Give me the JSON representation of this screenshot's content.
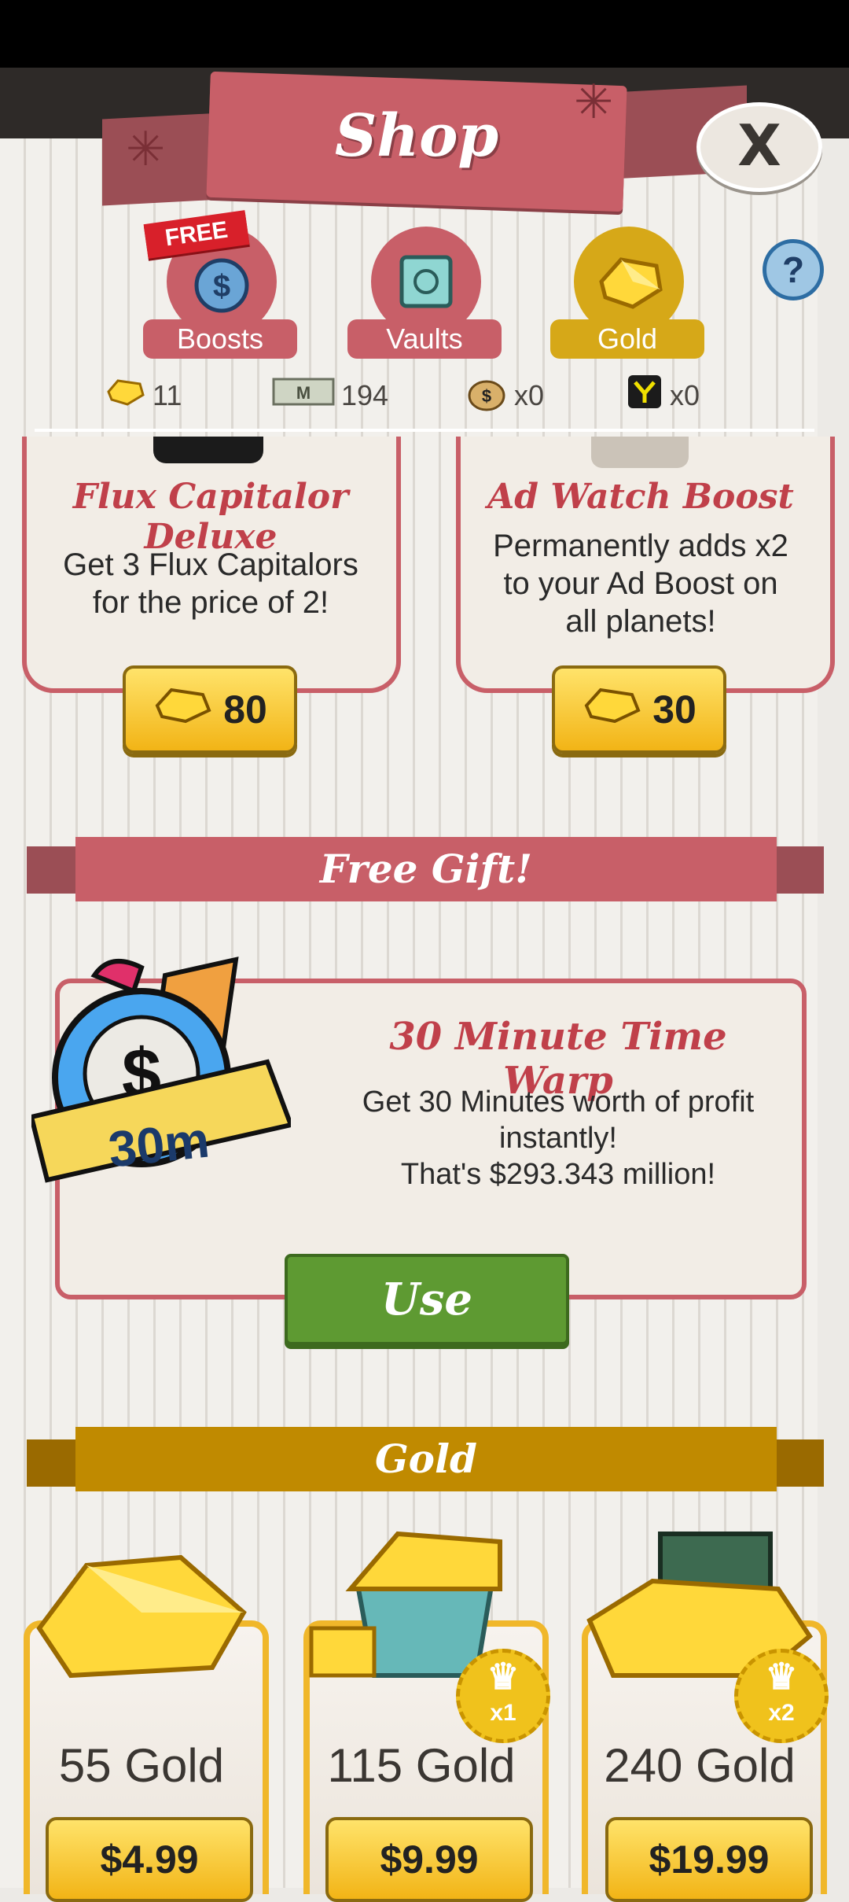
{
  "header": {
    "title": "Shop",
    "close_label": "X"
  },
  "tabs": [
    {
      "label": "Boosts",
      "icon": "money-bag-icon",
      "ribbon": "FREE"
    },
    {
      "label": "Vaults",
      "icon": "vault-icon"
    },
    {
      "label": "Gold",
      "icon": "gold-gem-icon",
      "active": true
    }
  ],
  "help_label": "?",
  "currencies": [
    {
      "icon": "gold-gem-icon",
      "value": "11"
    },
    {
      "icon": "megabucks-icon",
      "value": "194"
    },
    {
      "icon": "money-bag-icon",
      "value": "x0"
    },
    {
      "icon": "flux-capitalor-icon",
      "value": "x0"
    }
  ],
  "offers": [
    {
      "title": "Flux Capitalor Deluxe",
      "description": "Get 3 Flux Capitalors for the price of 2!",
      "price": "80"
    },
    {
      "title": "Ad Watch Boost",
      "description": "Permanently adds x2 to your Ad Boost on all planets!",
      "price": "30"
    }
  ],
  "free_gift": {
    "section_title": "Free Gift!",
    "title": "30 Minute Time Warp",
    "badge": "30m",
    "line1": "Get 30 Minutes worth of profit",
    "line2": "instantly!",
    "line3": "That's $293.343 million!",
    "button": "Use"
  },
  "gold_section": {
    "title": "Gold",
    "packs": [
      {
        "label": "55 Gold",
        "price": "$4.99"
      },
      {
        "label": "115 Gold",
        "price": "$9.99",
        "badge": "x1"
      },
      {
        "label": "240 Gold",
        "price": "$19.99",
        "badge": "x2"
      }
    ]
  },
  "colors": {
    "accent": "#c85f68",
    "gold": "#d6a818",
    "green": "#5e9a32"
  }
}
